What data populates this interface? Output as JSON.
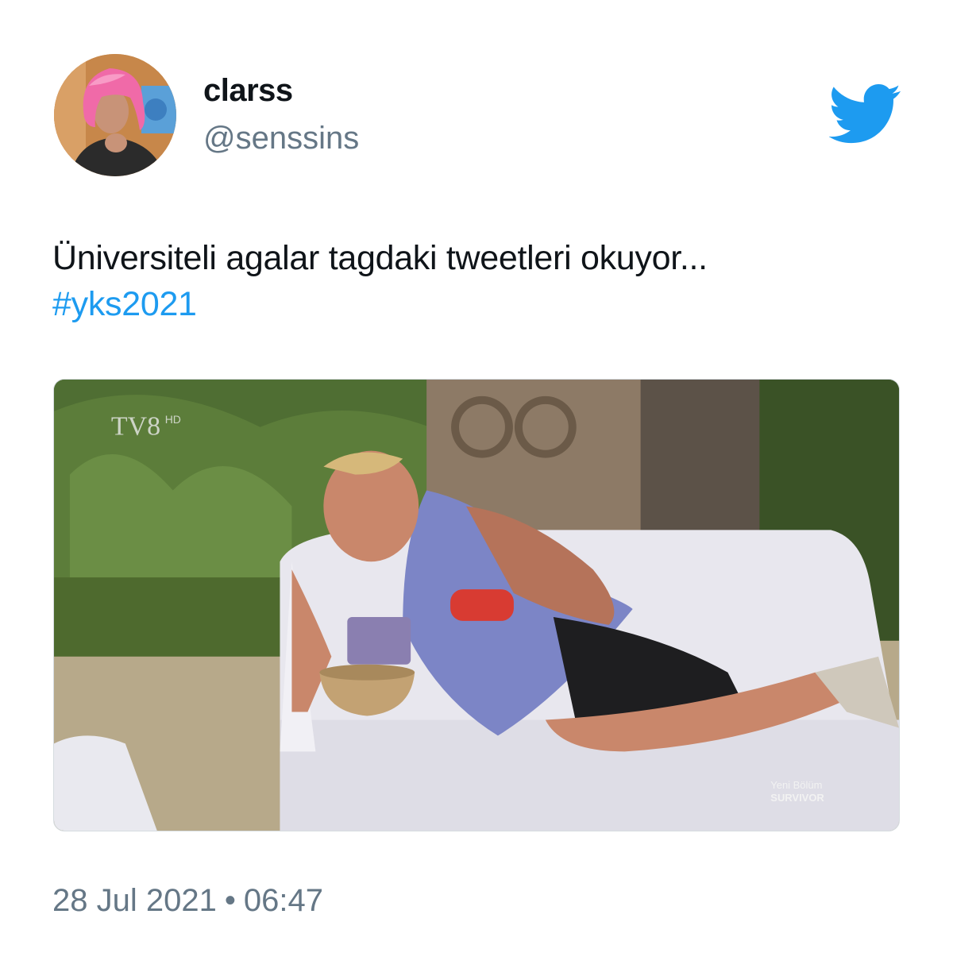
{
  "user": {
    "display_name": "clarss",
    "handle": "@senssins",
    "avatar_icon": "avatar-photo"
  },
  "brand": {
    "icon": "twitter-bird-icon",
    "color": "#1d9bf0"
  },
  "tweet": {
    "text": "Üniversiteli agalar tagdaki tweetleri okuyor...",
    "hashtag": "#yks2021"
  },
  "media": {
    "channel_logo": "TV8",
    "channel_logo_suffix": "HD",
    "overlay_line1": "Yeni Bölüm",
    "overlay_line2": "SURVIVOR"
  },
  "footer": {
    "date": "28 Jul 2021",
    "separator": "•",
    "time": "06:47"
  },
  "colors": {
    "text": "#0f1419",
    "secondary": "#657786",
    "link": "#1d9bf0"
  }
}
